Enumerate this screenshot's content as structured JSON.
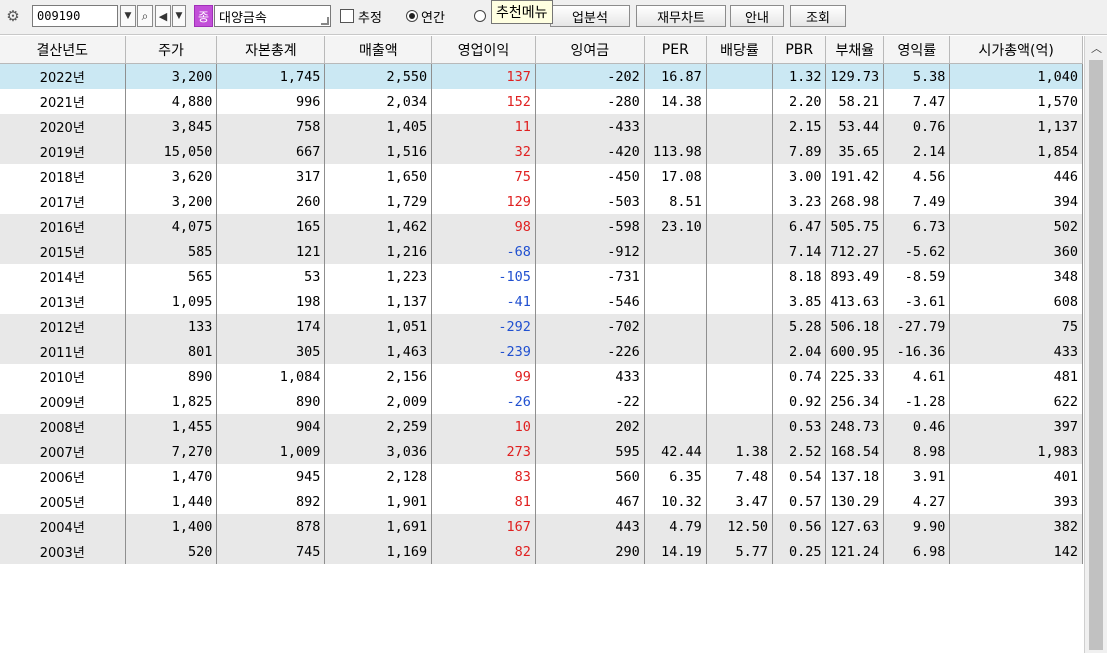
{
  "toolbar": {
    "code": "009190",
    "badge": "종",
    "company": "대양금속",
    "estimate_label": "추정",
    "radio_annual": "연간",
    "tooltip": "추천메뉴",
    "btn_analysis": "업분석",
    "btn_financial": "재무차트",
    "btn_guide": "안내",
    "btn_search": "조회"
  },
  "table": {
    "headers": [
      "결산년도",
      "주가",
      "자본총계",
      "매출액",
      "영업이익",
      "잉여금",
      "PER",
      "배당률",
      "PBR",
      "부채율",
      "영익률",
      "시가총액(억)"
    ],
    "rows": [
      {
        "year": "2022년",
        "price": "3,200",
        "equity": "1,745",
        "sales": "2,550",
        "op": "137",
        "op_sign": "pos",
        "retained": "-202",
        "per": "16.87",
        "div": "",
        "pbr": "1.32",
        "debt": "129.73",
        "margin": "5.38",
        "mcap": "1,040"
      },
      {
        "year": "2021년",
        "price": "4,880",
        "equity": "996",
        "sales": "2,034",
        "op": "152",
        "op_sign": "pos",
        "retained": "-280",
        "per": "14.38",
        "div": "",
        "pbr": "2.20",
        "debt": "58.21",
        "margin": "7.47",
        "mcap": "1,570"
      },
      {
        "year": "2020년",
        "price": "3,845",
        "equity": "758",
        "sales": "1,405",
        "op": "11",
        "op_sign": "pos",
        "retained": "-433",
        "per": "",
        "div": "",
        "pbr": "2.15",
        "debt": "53.44",
        "margin": "0.76",
        "mcap": "1,137"
      },
      {
        "year": "2019년",
        "price": "15,050",
        "equity": "667",
        "sales": "1,516",
        "op": "32",
        "op_sign": "pos",
        "retained": "-420",
        "per": "113.98",
        "div": "",
        "pbr": "7.89",
        "debt": "35.65",
        "margin": "2.14",
        "mcap": "1,854"
      },
      {
        "year": "2018년",
        "price": "3,620",
        "equity": "317",
        "sales": "1,650",
        "op": "75",
        "op_sign": "pos",
        "retained": "-450",
        "per": "17.08",
        "div": "",
        "pbr": "3.00",
        "debt": "191.42",
        "margin": "4.56",
        "mcap": "446"
      },
      {
        "year": "2017년",
        "price": "3,200",
        "equity": "260",
        "sales": "1,729",
        "op": "129",
        "op_sign": "pos",
        "retained": "-503",
        "per": "8.51",
        "div": "",
        "pbr": "3.23",
        "debt": "268.98",
        "margin": "7.49",
        "mcap": "394"
      },
      {
        "year": "2016년",
        "price": "4,075",
        "equity": "165",
        "sales": "1,462",
        "op": "98",
        "op_sign": "pos",
        "retained": "-598",
        "per": "23.10",
        "div": "",
        "pbr": "6.47",
        "debt": "505.75",
        "margin": "6.73",
        "mcap": "502"
      },
      {
        "year": "2015년",
        "price": "585",
        "equity": "121",
        "sales": "1,216",
        "op": "-68",
        "op_sign": "neg",
        "retained": "-912",
        "per": "",
        "div": "",
        "pbr": "7.14",
        "debt": "712.27",
        "margin": "-5.62",
        "mcap": "360"
      },
      {
        "year": "2014년",
        "price": "565",
        "equity": "53",
        "sales": "1,223",
        "op": "-105",
        "op_sign": "neg",
        "retained": "-731",
        "per": "",
        "div": "",
        "pbr": "8.18",
        "debt": "893.49",
        "margin": "-8.59",
        "mcap": "348"
      },
      {
        "year": "2013년",
        "price": "1,095",
        "equity": "198",
        "sales": "1,137",
        "op": "-41",
        "op_sign": "neg",
        "retained": "-546",
        "per": "",
        "div": "",
        "pbr": "3.85",
        "debt": "413.63",
        "margin": "-3.61",
        "mcap": "608"
      },
      {
        "year": "2012년",
        "price": "133",
        "equity": "174",
        "sales": "1,051",
        "op": "-292",
        "op_sign": "neg",
        "retained": "-702",
        "per": "",
        "div": "",
        "pbr": "5.28",
        "debt": "506.18",
        "margin": "-27.79",
        "mcap": "75"
      },
      {
        "year": "2011년",
        "price": "801",
        "equity": "305",
        "sales": "1,463",
        "op": "-239",
        "op_sign": "neg",
        "retained": "-226",
        "per": "",
        "div": "",
        "pbr": "2.04",
        "debt": "600.95",
        "margin": "-16.36",
        "mcap": "433"
      },
      {
        "year": "2010년",
        "price": "890",
        "equity": "1,084",
        "sales": "2,156",
        "op": "99",
        "op_sign": "pos",
        "retained": "433",
        "per": "",
        "div": "",
        "pbr": "0.74",
        "debt": "225.33",
        "margin": "4.61",
        "mcap": "481"
      },
      {
        "year": "2009년",
        "price": "1,825",
        "equity": "890",
        "sales": "2,009",
        "op": "-26",
        "op_sign": "neg",
        "retained": "-22",
        "per": "",
        "div": "",
        "pbr": "0.92",
        "debt": "256.34",
        "margin": "-1.28",
        "mcap": "622"
      },
      {
        "year": "2008년",
        "price": "1,455",
        "equity": "904",
        "sales": "2,259",
        "op": "10",
        "op_sign": "pos",
        "retained": "202",
        "per": "",
        "div": "",
        "pbr": "0.53",
        "debt": "248.73",
        "margin": "0.46",
        "mcap": "397"
      },
      {
        "year": "2007년",
        "price": "7,270",
        "equity": "1,009",
        "sales": "3,036",
        "op": "273",
        "op_sign": "pos",
        "retained": "595",
        "per": "42.44",
        "div": "1.38",
        "pbr": "2.52",
        "debt": "168.54",
        "margin": "8.98",
        "mcap": "1,983"
      },
      {
        "year": "2006년",
        "price": "1,470",
        "equity": "945",
        "sales": "2,128",
        "op": "83",
        "op_sign": "pos",
        "retained": "560",
        "per": "6.35",
        "div": "7.48",
        "pbr": "0.54",
        "debt": "137.18",
        "margin": "3.91",
        "mcap": "401"
      },
      {
        "year": "2005년",
        "price": "1,440",
        "equity": "892",
        "sales": "1,901",
        "op": "81",
        "op_sign": "pos",
        "retained": "467",
        "per": "10.32",
        "div": "3.47",
        "pbr": "0.57",
        "debt": "130.29",
        "margin": "4.27",
        "mcap": "393"
      },
      {
        "year": "2004년",
        "price": "1,400",
        "equity": "878",
        "sales": "1,691",
        "op": "167",
        "op_sign": "pos",
        "retained": "443",
        "per": "4.79",
        "div": "12.50",
        "pbr": "0.56",
        "debt": "127.63",
        "margin": "9.90",
        "mcap": "382"
      },
      {
        "year": "2003년",
        "price": "520",
        "equity": "745",
        "sales": "1,169",
        "op": "82",
        "op_sign": "pos",
        "retained": "290",
        "per": "14.19",
        "div": "5.77",
        "pbr": "0.25",
        "debt": "121.24",
        "margin": "6.98",
        "mcap": "142"
      }
    ]
  },
  "colors": {
    "selected_row": "#cbe8f3",
    "shaded_row": "#e8e8e8",
    "positive": "#e02020",
    "negative": "#2050d0",
    "badge": "#c24ed8"
  },
  "icons": {
    "gear": "gear-icon",
    "search": "search-icon",
    "speaker": "speaker-icon",
    "dropdown": "chevron-down-icon",
    "scroll_up": "chevron-up-icon"
  }
}
